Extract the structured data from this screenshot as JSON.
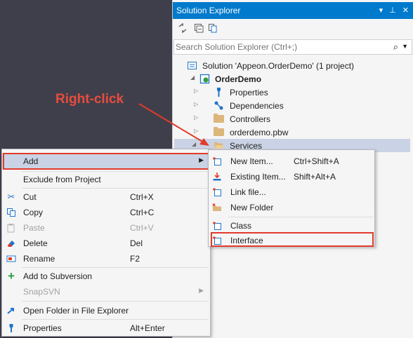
{
  "panel": {
    "title": "Solution Explorer",
    "title_buttons": "▾ ⊥ ✕",
    "search_placeholder": "Search Solution Explorer (Ctrl+;)"
  },
  "tree": {
    "solution": "Solution 'Appeon.OrderDemo' (1 project)",
    "project": "OrderDemo",
    "items": [
      {
        "label": "Properties",
        "icon": "wrench-icon"
      },
      {
        "label": "Dependencies",
        "icon": "dependencies-icon"
      },
      {
        "label": "Controllers",
        "icon": "folder-icon"
      },
      {
        "label": "orderdemo.pbw",
        "icon": "folder-icon"
      },
      {
        "label": "Services",
        "icon": "folder-open-icon"
      }
    ]
  },
  "annotation": {
    "text": "Right-click",
    "color": "#e84c3d"
  },
  "context_menu": {
    "items": [
      {
        "label": "Add",
        "shortcut": "",
        "has_submenu": true,
        "icon": ""
      },
      {
        "label": "Exclude from Project",
        "shortcut": "",
        "icon": ""
      },
      {
        "label": "Cut",
        "shortcut": "Ctrl+X",
        "icon": "scissors-icon"
      },
      {
        "label": "Copy",
        "shortcut": "Ctrl+C",
        "icon": "copy-icon"
      },
      {
        "label": "Paste",
        "shortcut": "Ctrl+V",
        "icon": "paste-icon",
        "disabled": true
      },
      {
        "label": "Delete",
        "shortcut": "Del",
        "icon": "eraser-icon"
      },
      {
        "label": "Rename",
        "shortcut": "F2",
        "icon": "rename-icon"
      },
      {
        "label": "Add to Subversion",
        "shortcut": "",
        "icon": "plus-icon"
      },
      {
        "label": "SnapSVN",
        "shortcut": "",
        "has_submenu": true,
        "disabled": true,
        "icon": ""
      },
      {
        "label": "Open Folder in File Explorer",
        "shortcut": "",
        "icon": "open-folder-icon"
      },
      {
        "label": "Properties",
        "shortcut": "Alt+Enter",
        "icon": "wrench-icon"
      }
    ]
  },
  "add_submenu": {
    "items": [
      {
        "label": "New Item...",
        "shortcut": "Ctrl+Shift+A",
        "icon": "new-item-icon"
      },
      {
        "label": "Existing Item...",
        "shortcut": "Shift+Alt+A",
        "icon": "existing-item-icon"
      },
      {
        "label": "Link file...",
        "shortcut": "",
        "icon": "link-file-icon"
      },
      {
        "label": "New Folder",
        "shortcut": "",
        "icon": "new-folder-icon"
      },
      {
        "label": "Class",
        "shortcut": "",
        "icon": "class-icon"
      },
      {
        "label": "Interface",
        "shortcut": "",
        "icon": "interface-icon"
      }
    ]
  },
  "colors": {
    "title_bar": "#007acc",
    "highlight": "#cad3e5",
    "callout": "#e23a2b",
    "dark_background": "#3f3f4b"
  }
}
